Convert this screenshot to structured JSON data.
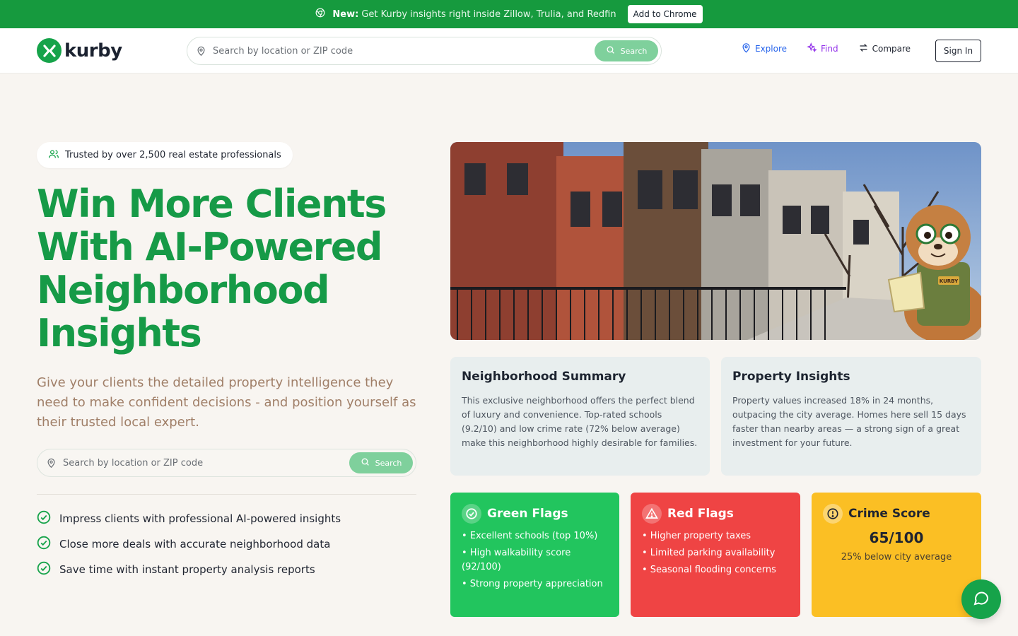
{
  "banner": {
    "new_label": "New:",
    "message": "Get Kurby insights right inside Zillow, Trulia, and Redfin",
    "cta_label": "Add to Chrome",
    "icon": "chrome-icon"
  },
  "nav": {
    "logo_text": "kurby",
    "search_placeholder": "Search by location or ZIP code",
    "search_button": "Search",
    "links": [
      {
        "label": "Explore",
        "icon": "map-pin-icon",
        "color": "#2563eb"
      },
      {
        "label": "Find",
        "icon": "sparkles-icon",
        "color": "#9333ea"
      },
      {
        "label": "Compare",
        "icon": "arrows-swap-icon",
        "color": "#1f2430"
      }
    ],
    "signin_label": "Sign In"
  },
  "hero": {
    "trust_badge": "Trusted by over 2,500 real estate professionals",
    "headline": "Win More Clients With AI-Powered Neighborhood Insights",
    "subheadline": "Give your clients the detailed property intelligence they need to make confident decisions - and position yourself as their trusted local expert.",
    "search_placeholder": "Search by location or ZIP code",
    "search_button": "Search",
    "features": [
      "Impress clients with professional AI-powered insights",
      "Close more deals with accurate neighborhood data",
      "Save time with instant property analysis reports"
    ],
    "mascot_badge": "KURBY"
  },
  "cards": {
    "summary": {
      "title": "Neighborhood Summary",
      "body": "This exclusive neighborhood offers the perfect blend of luxury and convenience. Top-rated schools (9.2/10) and low crime rate (72% below average) make this neighborhood highly desirable for families."
    },
    "insights": {
      "title": "Property Insights",
      "body": "Property values increased 18% in 24 months, outpacing the city average. Homes here sell 15 days faster than nearby areas — a strong sign of a great investment for your future."
    },
    "green_flags": {
      "title": "Green Flags",
      "color": "#22c55e",
      "items": [
        "• Excellent schools (top 10%)",
        "• High walkability score (92/100)",
        "• Strong property appreciation"
      ]
    },
    "red_flags": {
      "title": "Red Flags",
      "color": "#ef4444",
      "items": [
        "• Higher property taxes",
        "• Limited parking availability",
        "• Seasonal flooding concerns"
      ]
    },
    "crime": {
      "title": "Crime Score",
      "color": "#fbbf24",
      "score": "65/100",
      "note": "25% below city average"
    }
  },
  "colors": {
    "brand_green": "#16a34a",
    "headline_green": "#169a47",
    "banner_green": "#169a3e"
  }
}
